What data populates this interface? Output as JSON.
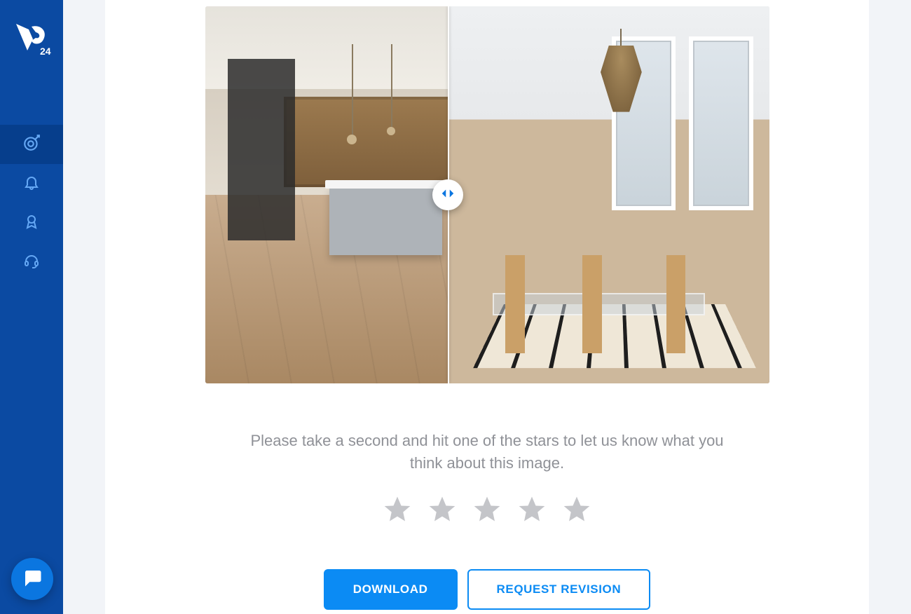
{
  "brand": {
    "name": "VS24"
  },
  "sidebar": {
    "items": [
      {
        "name": "dashboard",
        "active": true
      },
      {
        "name": "notifications"
      },
      {
        "name": "orders"
      },
      {
        "name": "support"
      }
    ]
  },
  "compare": {
    "slider_position_pct": 43
  },
  "rating": {
    "prompt": "Please take a second and hit one of the stars to let us know what you think about this image.",
    "max_stars": 5,
    "value": 0
  },
  "actions": {
    "download_label": "DOWNLOAD",
    "revision_label": "REQUEST REVISION"
  },
  "chat": {
    "label": "Chat"
  }
}
